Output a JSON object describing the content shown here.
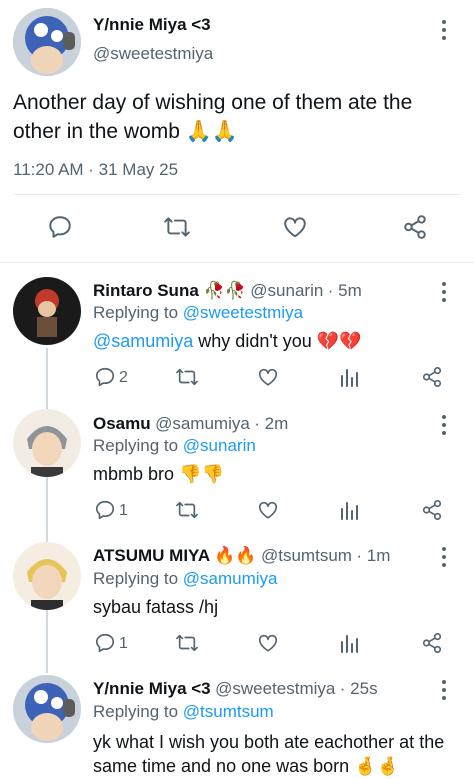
{
  "main_tweet": {
    "display_name": "Y/nnie Miya <3",
    "handle": "@sweetestmiya",
    "text_line1": "Another day of wishing one of them ate the",
    "text_line2": "other in the womb 🙏🙏",
    "timestamp": "11:20 AM · 31 May 25"
  },
  "replies": [
    {
      "display_name": "Rintaro Suna 🥀🥀",
      "handle": "@sunarin",
      "time": "· 5m",
      "replying_prefix": "Replying to ",
      "replying_to": "@sweetestmiya",
      "mention": "@samumiya",
      "text": " why didn't you 💔💔",
      "reply_count": "2"
    },
    {
      "display_name": "Osamu",
      "handle": "@samumiya",
      "time": "· 2m",
      "replying_prefix": "Replying to ",
      "replying_to": "@sunarin",
      "text": "mbmb bro 👎👎",
      "reply_count": "1"
    },
    {
      "display_name": "ATSUMU MIYA 🔥🔥",
      "handle": "@tsumtsum",
      "time": "· 1m",
      "replying_prefix": "Replying to ",
      "replying_to": "@samumiya",
      "text": "sybau fatass /hj",
      "reply_count": "1"
    },
    {
      "display_name": "Y/nnie Miya <3",
      "handle": "@sweetestmiya",
      "time": "· 25s",
      "replying_prefix": "Replying to ",
      "replying_to": "@tsumtsum",
      "text_line1": "yk what I wish you both ate eachother at the",
      "text_line2": "same time and no one was born 🤞🤞"
    }
  ],
  "colors": {
    "accent": "#1d9bf0",
    "muted": "#536471",
    "divider": "#e6ecf0"
  }
}
